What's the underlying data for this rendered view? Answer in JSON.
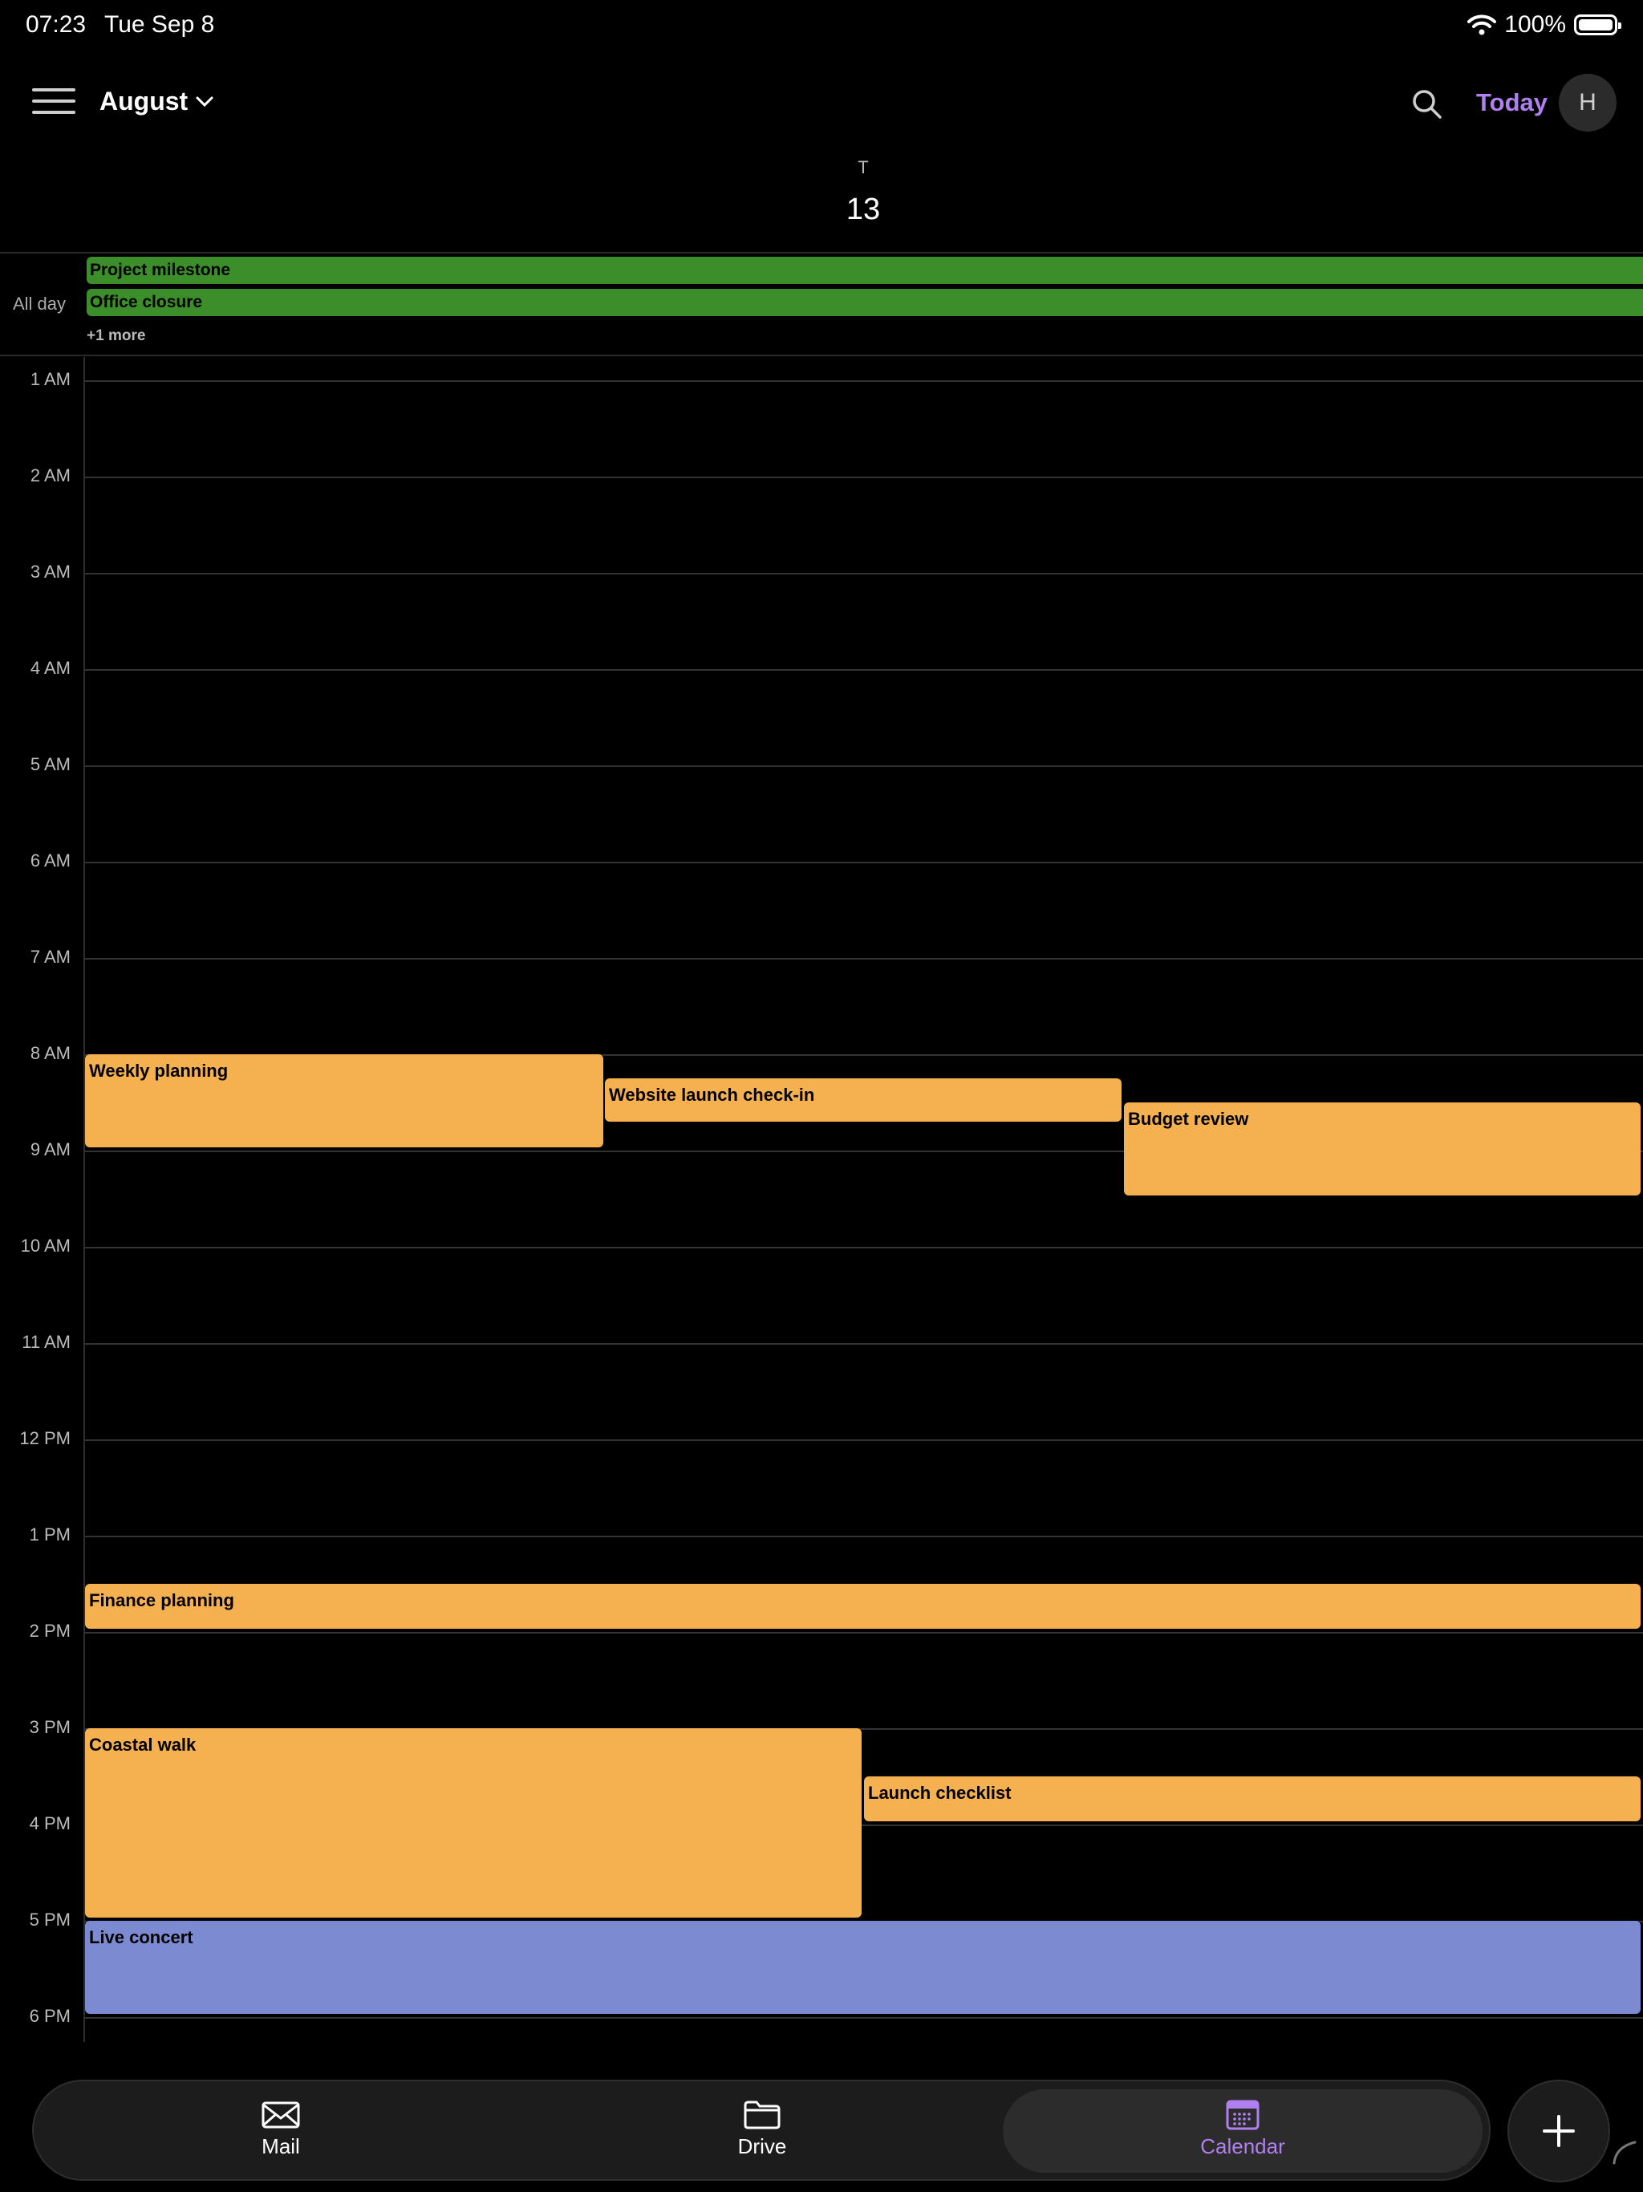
{
  "status_bar": {
    "time": "07:23",
    "date": "Tue Sep 8",
    "battery": "100%"
  },
  "header": {
    "month": "August",
    "today_label": "Today",
    "avatar_initial": "H"
  },
  "day": {
    "weekday": "T",
    "number": "13"
  },
  "all_day": {
    "label": "All day",
    "events": [
      "Project milestone",
      "Office closure"
    ],
    "more": "+1 more"
  },
  "hours": [
    "1 AM",
    "2 AM",
    "3 AM",
    "4 AM",
    "5 AM",
    "6 AM",
    "7 AM",
    "8 AM",
    "9 AM",
    "10 AM",
    "11 AM",
    "12 PM",
    "1 PM",
    "2 PM",
    "3 PM",
    "4 PM",
    "5 PM",
    "6 PM"
  ],
  "events": [
    {
      "title": "Weekly planning",
      "color": "#f5b04f"
    },
    {
      "title": "Website launch check-in",
      "color": "#f5b04f"
    },
    {
      "title": "Budget review",
      "color": "#f5b04f"
    },
    {
      "title": "Finance planning",
      "color": "#f5b04f"
    },
    {
      "title": "Coastal walk",
      "color": "#f5b04f"
    },
    {
      "title": "Launch checklist",
      "color": "#f5b04f"
    },
    {
      "title": "Live concert",
      "color": "#7c8ad1"
    }
  ],
  "tabs": [
    {
      "label": "Mail",
      "icon": "mail-icon"
    },
    {
      "label": "Drive",
      "icon": "folder-icon"
    },
    {
      "label": "Calendar",
      "icon": "calendar-icon",
      "active": true
    }
  ],
  "accent_color": "#b07ff0"
}
